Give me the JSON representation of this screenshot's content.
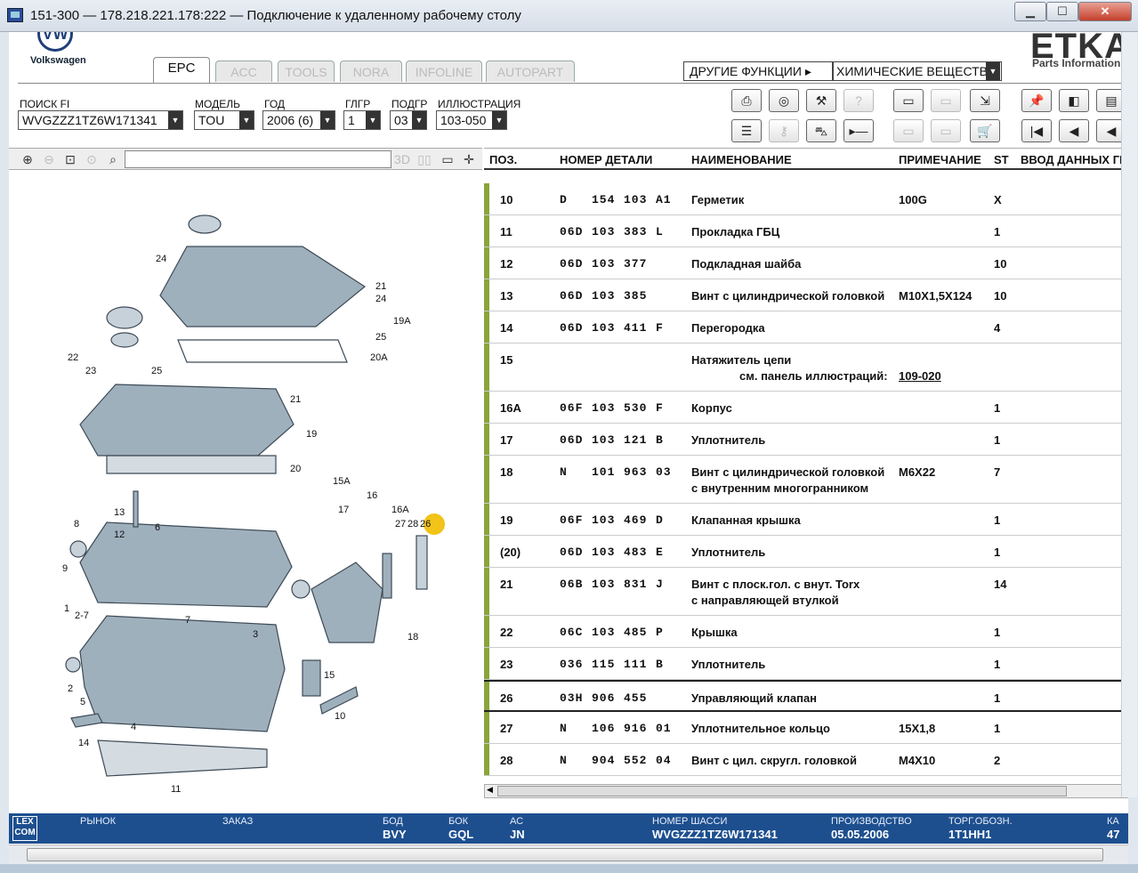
{
  "window": {
    "title": "151-300 — 178.218.221.178:222 — Подключение к удаленному рабочему столу",
    "btn_min": "▁",
    "btn_max": "☐",
    "btn_close": "✕"
  },
  "header": {
    "brand": "Volkswagen",
    "logo_letters": "VW",
    "etka": "ETKA",
    "etka_sub": "Parts Information",
    "tabs": [
      "EPC",
      "ACC",
      "TOOLS",
      "NORA",
      "INFOLINE",
      "AUTOPART"
    ],
    "other_functions": "ДРУГИЕ ФУНКЦИИ ▸",
    "chem_select": "ХИМИЧЕСКИЕ ВЕЩЕСТВА"
  },
  "filters": {
    "search_label": "ПОИСК FI",
    "search_value": "WVGZZZ1TZ6W171341",
    "model_label": "МОДЕЛЬ",
    "model_value": "TOU",
    "year_label": "ГОД",
    "year_value": "2006 (6)",
    "glgr_label": "ГЛГР",
    "glgr_value": "1",
    "podgr_label": "ПОДГР",
    "podgr_value": "03",
    "illus_label": "ИЛЛЮСТРАЦИЯ",
    "illus_value": "103-050"
  },
  "zoom_toolbar": {
    "btn_3d": "3D"
  },
  "table": {
    "headers": {
      "pos": "ПОЗ.",
      "part_no": "НОМЕР ДЕТАЛИ",
      "name": "НАИМЕНОВАНИЕ",
      "note": "ПРИМЕЧАНИЕ",
      "st": "ST",
      "input": "ВВОД ДАННЫХ ГР"
    },
    "rows": [
      {
        "pos": "10",
        "p1": "D",
        "p2": "154",
        "p3": "103",
        "p4": "A1",
        "name": "Герметик",
        "name2": "",
        "note": "100G",
        "st": "X"
      },
      {
        "pos": "11",
        "p1": "06D",
        "p2": "103",
        "p3": "383",
        "p4": "L",
        "name": "Прокладка ГБЦ",
        "name2": "",
        "note": "",
        "st": "1"
      },
      {
        "pos": "12",
        "p1": "06D",
        "p2": "103",
        "p3": "377",
        "p4": "",
        "name": "Подкладная шайба",
        "name2": "",
        "note": "",
        "st": "10"
      },
      {
        "pos": "13",
        "p1": "06D",
        "p2": "103",
        "p3": "385",
        "p4": "",
        "name": "Винт с цилиндрической головкой",
        "name2": "",
        "note": "M10X1,5X124",
        "st": "10"
      },
      {
        "pos": "14",
        "p1": "06D",
        "p2": "103",
        "p3": "411",
        "p4": "F",
        "name": "Перегородка",
        "name2": "",
        "note": "",
        "st": "4"
      },
      {
        "pos": "15",
        "p1": "",
        "p2": "",
        "p3": "",
        "p4": "",
        "name": "Натяжитель цепи",
        "name2": "см. панель иллюстраций:",
        "link": "109-020",
        "note": "",
        "st": ""
      },
      {
        "pos": "16A",
        "p1": "06F",
        "p2": "103",
        "p3": "530",
        "p4": "F",
        "name": "Корпус",
        "name2": "",
        "note": "",
        "st": "1"
      },
      {
        "pos": "17",
        "p1": "06D",
        "p2": "103",
        "p3": "121",
        "p4": "B",
        "name": "Уплотнитель",
        "name2": "",
        "note": "",
        "st": "1"
      },
      {
        "pos": "18",
        "p1": "N",
        "p2": "101",
        "p3": "963",
        "p4": "03",
        "name": "Винт с цилиндрической головкой",
        "name2": "с внутренним многогранником",
        "note": "M6X22",
        "st": "7"
      },
      {
        "pos": "19",
        "p1": "06F",
        "p2": "103",
        "p3": "469",
        "p4": "D",
        "name": "Клапанная крышка",
        "name2": "",
        "note": "",
        "st": "1"
      },
      {
        "pos": "(20)",
        "p1": "06D",
        "p2": "103",
        "p3": "483",
        "p4": "E",
        "name": "Уплотнитель",
        "name2": "",
        "note": "",
        "st": "1"
      },
      {
        "pos": "21",
        "p1": "06B",
        "p2": "103",
        "p3": "831",
        "p4": "J",
        "name": "Винт с плоск.гол. с внут. Torx",
        "name2": "с направляющей втулкой",
        "note": "",
        "st": "14"
      },
      {
        "pos": "22",
        "p1": "06C",
        "p2": "103",
        "p3": "485",
        "p4": "P",
        "name": "Крышка",
        "name2": "",
        "note": "",
        "st": "1"
      },
      {
        "pos": "23",
        "p1": "036",
        "p2": "115",
        "p3": "111",
        "p4": "B",
        "name": "Уплотнитель",
        "name2": "",
        "note": "",
        "st": "1"
      },
      {
        "pos": "26",
        "p1": "03H",
        "p2": "906",
        "p3": "455",
        "p4": "",
        "name": "Управляющий клапан",
        "name2": "",
        "note": "",
        "st": "1"
      },
      {
        "pos": "27",
        "p1": "N",
        "p2": "106",
        "p3": "916",
        "p4": "01",
        "name": "Уплотнительное кольцо",
        "name2": "",
        "note": "15X1,8",
        "st": "1"
      },
      {
        "pos": "28",
        "p1": "N",
        "p2": "904",
        "p3": "552",
        "p4": "04",
        "name": "Винт с цил. скругл. головкой",
        "name2": "",
        "note": "M4X10",
        "st": "2"
      }
    ]
  },
  "diagram_labels": [
    "24",
    "21",
    "24",
    "19A",
    "25",
    "22",
    "23",
    "25",
    "20A",
    "21",
    "19",
    "20",
    "15A",
    "16",
    "17",
    "16A",
    "27",
    "28",
    "26",
    "8",
    "13",
    "6",
    "12",
    "9",
    "1",
    "2-7",
    "7",
    "3",
    "18",
    "15",
    "2",
    "5",
    "4",
    "10",
    "14",
    "11"
  ],
  "status": {
    "lexcom": "LEX COM",
    "market_label": "РЫНОК",
    "order_label": "ЗАКАЗ",
    "bod_label": "БОД",
    "bod_value": "BVY",
    "bok_label": "БОК",
    "bok_value": "GQL",
    "ac_label": "АС",
    "ac_value": "JN",
    "chassis_label": "НОМЕР ШАССИ",
    "chassis_value": "WVGZZZ1TZ6W171341",
    "prod_label": "ПРОИЗВОДСТВО",
    "prod_value": "05.05.2006",
    "torg_label": "ТОРГ.ОБОЗН.",
    "torg_value": "1T1HH1",
    "ka_label": "КА",
    "ka_value": "47"
  },
  "colors": {
    "row_marker": "#8aa53c",
    "status_bg": "#1d4f8f",
    "highlight_marker": "#f2c318"
  }
}
